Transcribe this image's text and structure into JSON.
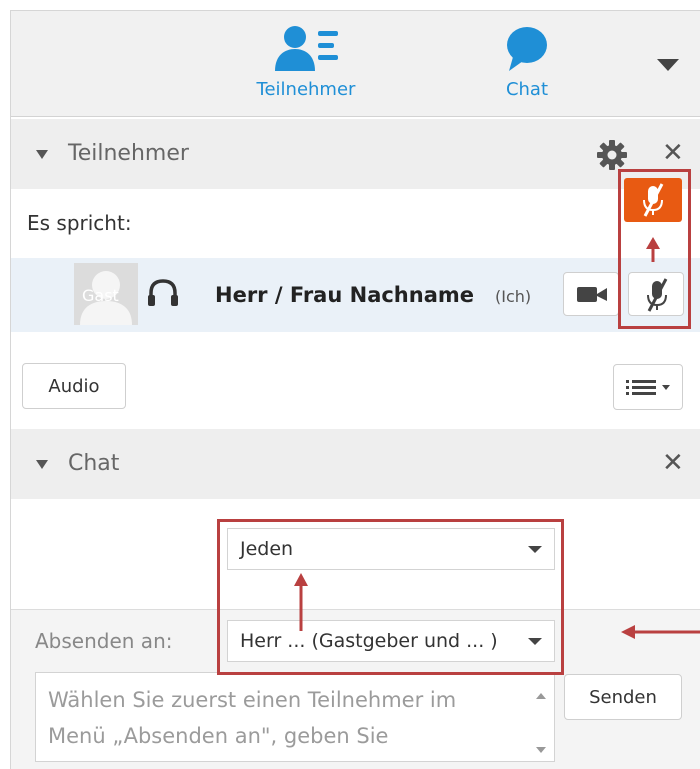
{
  "tabs": [
    {
      "label": "Teilnehmer",
      "icon": "participants-icon"
    },
    {
      "label": "Chat",
      "icon": "chat-bubble-icon"
    }
  ],
  "participants_panel": {
    "title": "Teilnehmer",
    "speaking_label": "Es spricht:",
    "participant": {
      "avatar_text": "Gast",
      "name": "Herr / Frau Nachname",
      "tag": "(Ich)"
    },
    "audio_button": "Audio"
  },
  "chat_panel": {
    "title": "Chat",
    "recipient_select": "Jeden",
    "send_to_label": "Absenden an:",
    "send_to_select": "Herr ... (Gastgeber und ... )",
    "message_placeholder": "Wählen Sie zuerst einen Teilnehmer im Menü „Absenden an\", geben Sie",
    "send_button": "Senden"
  },
  "colors": {
    "accent_blue": "#1f8fd6",
    "mute_active_orange": "#e85a12",
    "annotation_red": "#b94040"
  }
}
